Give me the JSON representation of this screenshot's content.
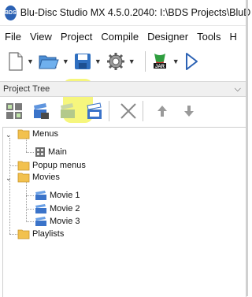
{
  "window": {
    "title": "Blu-Disc Studio MX 4.5.0.2040: I:\\BDS Projects\\BluD",
    "app_icon_text": "BDS"
  },
  "menu": [
    "File",
    "View",
    "Project",
    "Compile",
    "Designer",
    "Tools",
    "H"
  ],
  "toolbar": {
    "icons": [
      "new-file-icon",
      "open-folder-icon",
      "save-icon",
      "settings-gear-icon",
      "jar-icon",
      "play-icon"
    ],
    "jar_label": "JAR"
  },
  "panel": {
    "title": "Project Tree",
    "pin_glyph": "⌵"
  },
  "tree_toolbar": {
    "icons": [
      "expand-all-icon",
      "add-movie-icon",
      "add-clip-icon",
      "clapper-icon",
      "delete-icon",
      "move-up-icon",
      "move-down-icon"
    ],
    "highlighted": "add-clip-icon",
    "highlight_color": "#f5f566"
  },
  "tree": {
    "menus": "Menus",
    "main": "Main",
    "popup_menus": "Popup menus",
    "movies": "Movies",
    "movie1": "Movie 1",
    "movie2": "Movie 2",
    "movie3": "Movie 3",
    "playlists": "Playlists"
  },
  "colors": {
    "folder": "#f2c14e",
    "movie_icon": "#3a73c9",
    "accent": "#2c62b4"
  }
}
